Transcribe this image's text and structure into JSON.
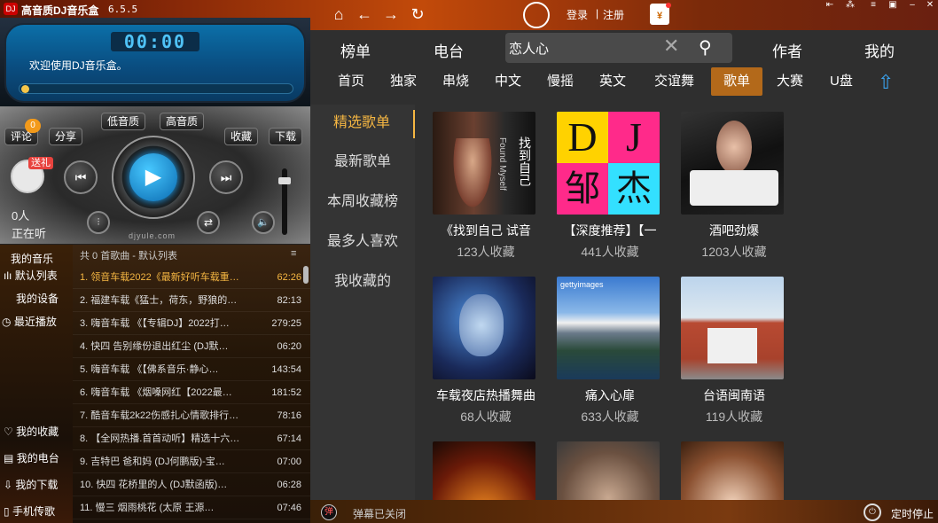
{
  "app": {
    "title": "高音质DJ音乐盒",
    "version": "6.5.5",
    "icon": "DJ"
  },
  "topbar": {
    "login": "登录",
    "separator": "|",
    "register": "注册",
    "gift": "¥"
  },
  "player": {
    "time": "00:00",
    "welcome": "欢迎使用DJ音乐盒。",
    "progress": 0.0,
    "brand": "djyule.com"
  },
  "controls": {
    "comment": "评论",
    "comment_count": "0",
    "share": "分享",
    "low_quality": "低音质",
    "high_quality": "高音质",
    "favorite": "收藏",
    "download": "下载",
    "gift_badge": "送礼",
    "listeners": "0人",
    "listening": "正在听"
  },
  "sidenav": {
    "my_music": "我的音乐",
    "default_list": "默认列表",
    "my_device": "我的设备",
    "recent": "最近播放",
    "my_favorites": "我的收藏",
    "my_radio": "我的电台",
    "my_downloads": "我的下载",
    "phone_transfer": "手机传歌"
  },
  "playlist": {
    "header": "共 0 首歌曲 - 默认列表",
    "rows": [
      {
        "title": "1. 领音车载2022《最新好听车载重…",
        "duration": "62:26"
      },
      {
        "title": "2. 福建车载《猛士，荷东，野狼的…",
        "duration": "82:13"
      },
      {
        "title": "3. 嗨音车载 《【专辑DJ】2022打…",
        "duration": "279:25"
      },
      {
        "title": "4. 快四  告别缘份退出红尘 (DJ默…",
        "duration": "06:20"
      },
      {
        "title": "5. 嗨音车载 《【佛系音乐·静心…",
        "duration": "143:54"
      },
      {
        "title": "6. 嗨音车载 《烟嗓网红【2022最…",
        "duration": "181:52"
      },
      {
        "title": "7. 酷音车载2k22伤感扎心情歌排行…",
        "duration": "78:16"
      },
      {
        "title": "8. 【全网热播.首首动听】精选十六…",
        "duration": "67:14"
      },
      {
        "title": "9. 吉特巴  爸和妈 (DJ何鹏版)-宝…",
        "duration": "07:00"
      },
      {
        "title": "10. 快四  花桥里的人 (DJ默函版)…",
        "duration": "06:28"
      },
      {
        "title": "11. 慢三  烟雨桃花 (太原 王源…",
        "duration": "07:46"
      }
    ]
  },
  "tabs_main": [
    "榜单",
    "电台",
    "作者",
    "我的"
  ],
  "search": {
    "value": "恋人心",
    "clear": "✕"
  },
  "tabs_sub": [
    "首页",
    "独家",
    "串烧",
    "中文",
    "慢摇",
    "英文",
    "交谊舞",
    "歌单",
    "大赛",
    "U盘"
  ],
  "categories": [
    "精选歌单",
    "最新歌单",
    "本周收藏榜",
    "最多人喜欢",
    "我收藏的"
  ],
  "cards": [
    {
      "title": "《找到自己 试音",
      "fav": "123人收藏"
    },
    {
      "title": "【深度推荐】【一",
      "fav": "441人收藏"
    },
    {
      "title": "酒吧劲爆",
      "fav": "1203人收藏"
    },
    {
      "title": "车载夜店热播舞曲",
      "fav": "68人收藏"
    },
    {
      "title": "痛入心扉",
      "fav": "633人收藏"
    },
    {
      "title": "台语闽南语",
      "fav": "119人收藏"
    }
  ],
  "dj_art": {
    "d": "D",
    "j": "J",
    "zou": "邹",
    "jie": "杰"
  },
  "album_text": {
    "zhaodao": "找到自己",
    "found": "Found Myself",
    "getty": "gettyimages"
  },
  "status": {
    "danmu": "弹幕已关闭",
    "timer": "定时停止"
  }
}
